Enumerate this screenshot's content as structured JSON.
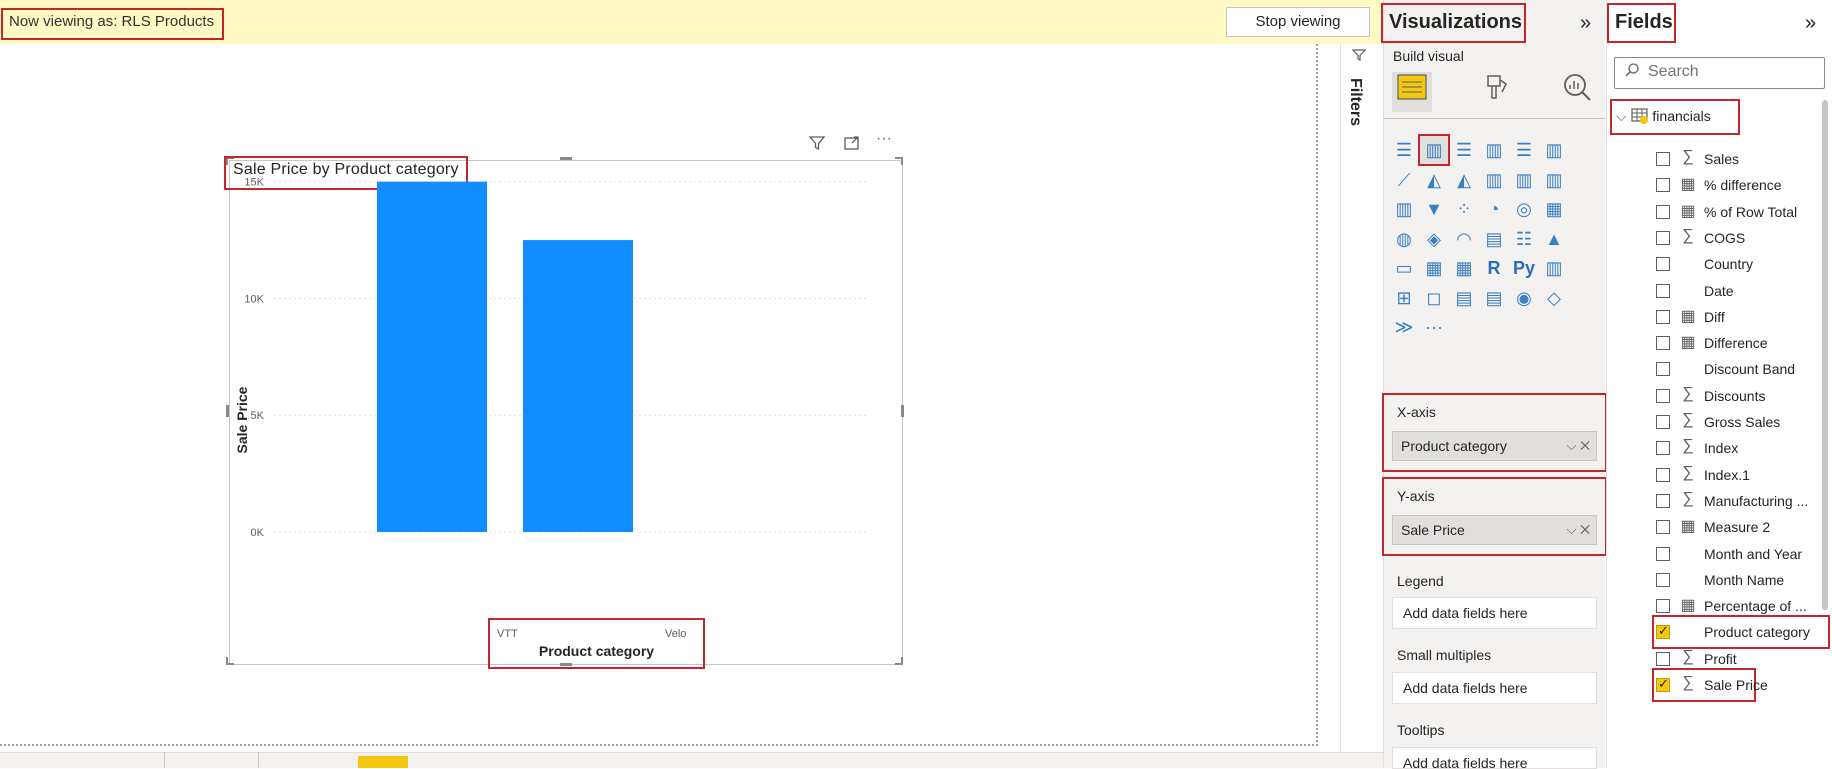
{
  "banner": {
    "viewing_label": "Now viewing as: RLS Products",
    "stop_button": "Stop viewing"
  },
  "visual": {
    "title": "Sale Price by Product category",
    "icons": [
      "filter-icon",
      "focus-mode-icon",
      "more-options-icon"
    ]
  },
  "chart_data": {
    "type": "bar",
    "title": "Sale Price by Product category",
    "xlabel": "Product category",
    "ylabel": "Sale Price",
    "categories": [
      "VTT",
      "Velo"
    ],
    "values": [
      15000,
      12500
    ],
    "y_ticks": [
      "15K",
      "10K",
      "5K",
      "0K"
    ],
    "y_tick_values": [
      15000,
      10000,
      5000,
      0
    ],
    "ylim": [
      0,
      15500
    ],
    "bar_color": "#118dff",
    "grid": true
  },
  "filters": {
    "label": "Filters"
  },
  "visualizations": {
    "title": "Visualizations",
    "build_visual": "Build visual",
    "tabs": [
      "build-visual-tab",
      "format-visual-tab",
      "analytics-tab"
    ],
    "wells": {
      "xaxis": {
        "title": "X-axis",
        "field": "Product category"
      },
      "yaxis": {
        "title": "Y-axis",
        "field": "Sale Price"
      },
      "legend": {
        "title": "Legend",
        "placeholder": "Add data fields here"
      },
      "small_multiples": {
        "title": "Small multiples",
        "placeholder": "Add data fields here"
      },
      "tooltips": {
        "title": "Tooltips",
        "placeholder": "Add data fields here"
      }
    }
  },
  "fields": {
    "title": "Fields",
    "search_placeholder": "Search",
    "table_name": "financials",
    "items": [
      {
        "name": "Sales",
        "icon": "sigma",
        "checked": false
      },
      {
        "name": "% difference",
        "icon": "calc",
        "checked": false
      },
      {
        "name": "% of Row Total",
        "icon": "calc",
        "checked": false
      },
      {
        "name": "COGS",
        "icon": "sigma",
        "checked": false
      },
      {
        "name": "Country",
        "icon": "none",
        "checked": false
      },
      {
        "name": "Date",
        "icon": "none",
        "checked": false
      },
      {
        "name": "Diff",
        "icon": "calc",
        "checked": false
      },
      {
        "name": "Difference",
        "icon": "calc",
        "checked": false
      },
      {
        "name": "Discount Band",
        "icon": "none",
        "checked": false
      },
      {
        "name": "Discounts",
        "icon": "sigma",
        "checked": false
      },
      {
        "name": "Gross Sales",
        "icon": "sigma",
        "checked": false
      },
      {
        "name": "Index",
        "icon": "sigma",
        "checked": false
      },
      {
        "name": "Index.1",
        "icon": "sigma",
        "checked": false
      },
      {
        "name": "Manufacturing ...",
        "icon": "sigma",
        "checked": false
      },
      {
        "name": "Measure 2",
        "icon": "calc",
        "checked": false
      },
      {
        "name": "Month and Year",
        "icon": "none",
        "checked": false
      },
      {
        "name": "Month Name",
        "icon": "none",
        "checked": false
      },
      {
        "name": "Percentage of ...",
        "icon": "calc",
        "checked": false
      },
      {
        "name": "Product category",
        "icon": "none",
        "checked": true
      },
      {
        "name": "Profit",
        "icon": "sigma",
        "checked": false
      },
      {
        "name": "Sale Price",
        "icon": "sigma",
        "checked": true
      }
    ]
  }
}
